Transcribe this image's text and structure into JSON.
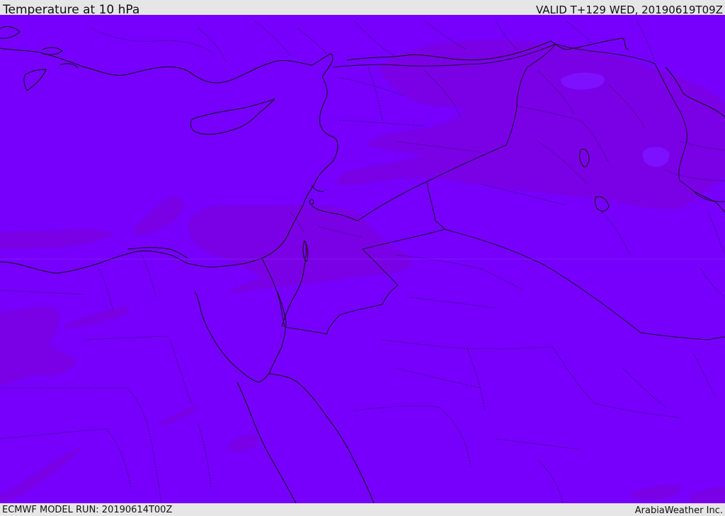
{
  "header": {
    "title": "Temperature at 10 hPa",
    "valid_time": "VALID T+129 WED, 20190619T09Z"
  },
  "footer": {
    "model_run": "ECMWF MODEL RUN: 20190614T00Z",
    "credit": "ArabiaWeather Inc."
  },
  "map": {
    "variable": "temperature",
    "level": "10 hPa",
    "fill_colors": {
      "base": "#7600fc",
      "warmer_band": "#7a00e6"
    },
    "line_colors": {
      "coastline": "#101010",
      "country_border": "#1a1030",
      "region_border": "#2a1860"
    }
  }
}
